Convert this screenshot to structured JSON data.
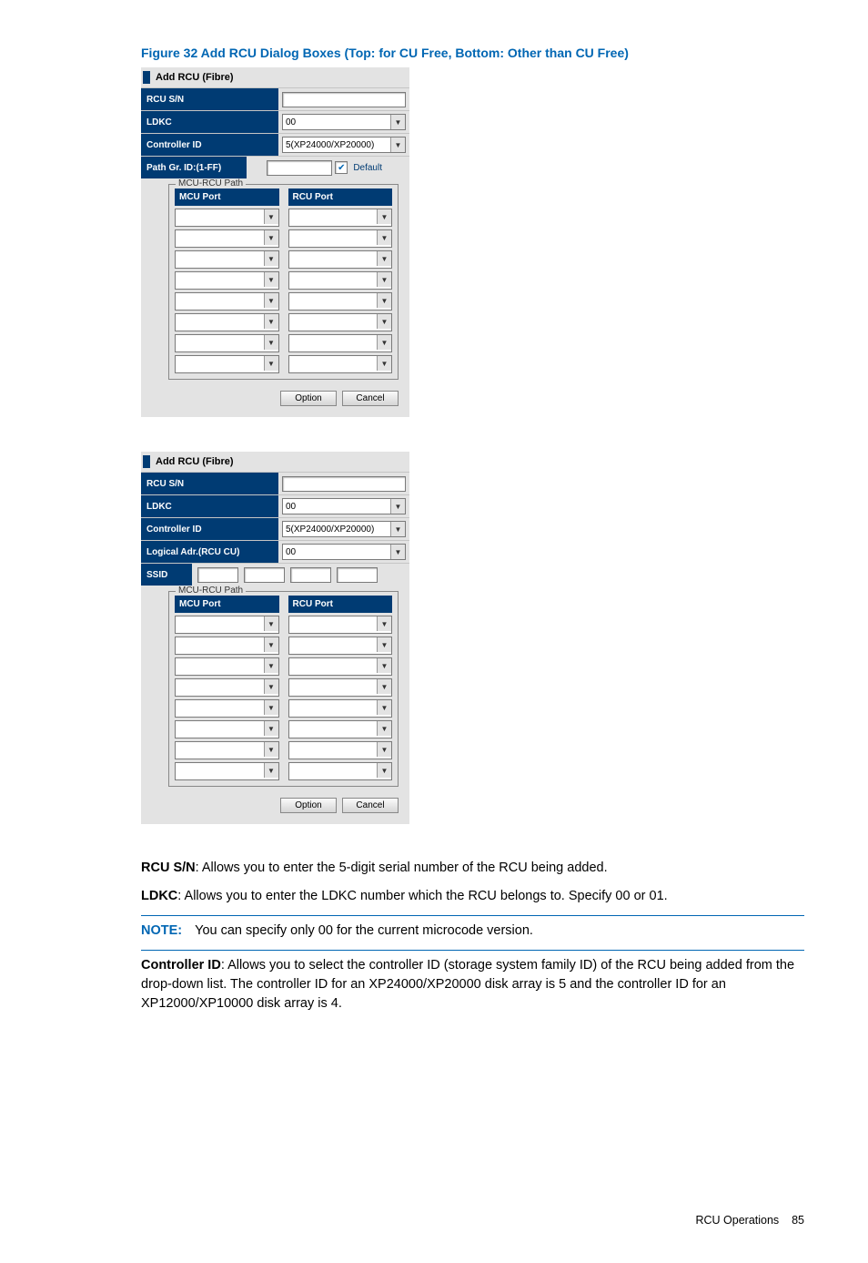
{
  "figure_caption": "Figure 32 Add RCU Dialog Boxes (Top: for CU Free, Bottom: Other than CU Free)",
  "dialog1": {
    "title": "Add RCU (Fibre)",
    "rcu_sn_label": "RCU S/N",
    "ldkc_label": "LDKC",
    "ldkc_value": "00",
    "controller_id_label": "Controller ID",
    "controller_id_value": "5(XP24000/XP20000)",
    "path_gr_label": "Path Gr. ID:(1-FF)",
    "default_label": "Default",
    "path_legend": "MCU-RCU Path",
    "mcu_port_header": "MCU Port",
    "rcu_port_header": "RCU Port",
    "option_btn": "Option",
    "cancel_btn": "Cancel"
  },
  "dialog2": {
    "title": "Add RCU (Fibre)",
    "rcu_sn_label": "RCU S/N",
    "ldkc_label": "LDKC",
    "ldkc_value": "00",
    "controller_id_label": "Controller ID",
    "controller_id_value": "5(XP24000/XP20000)",
    "logical_adr_label": "Logical Adr.(RCU CU)",
    "logical_adr_value": "00",
    "ssid_label": "SSID",
    "path_legend": "MCU-RCU Path",
    "mcu_port_header": "MCU Port",
    "rcu_port_header": "RCU Port",
    "option_btn": "Option",
    "cancel_btn": "Cancel"
  },
  "desc": {
    "rcu_sn": "RCU S/N",
    "rcu_sn_text": ": Allows you to enter the 5-digit serial number of the RCU being added.",
    "ldkc": "LDKC",
    "ldkc_text": ": Allows you to enter the LDKC number which the RCU belongs to. Specify 00 or 01.",
    "note_lbl": "NOTE:",
    "note_text": "You can specify only 00 for the current microcode version.",
    "controller_id": "Controller ID",
    "controller_id_text": ": Allows you to select the controller ID (storage system family ID) of the RCU being added from the drop-down list. The controller ID for an XP24000/XP20000 disk array is 5 and the controller ID for an XP12000/XP10000 disk array is 4."
  },
  "footer": {
    "section": "RCU Operations",
    "page": "85"
  }
}
